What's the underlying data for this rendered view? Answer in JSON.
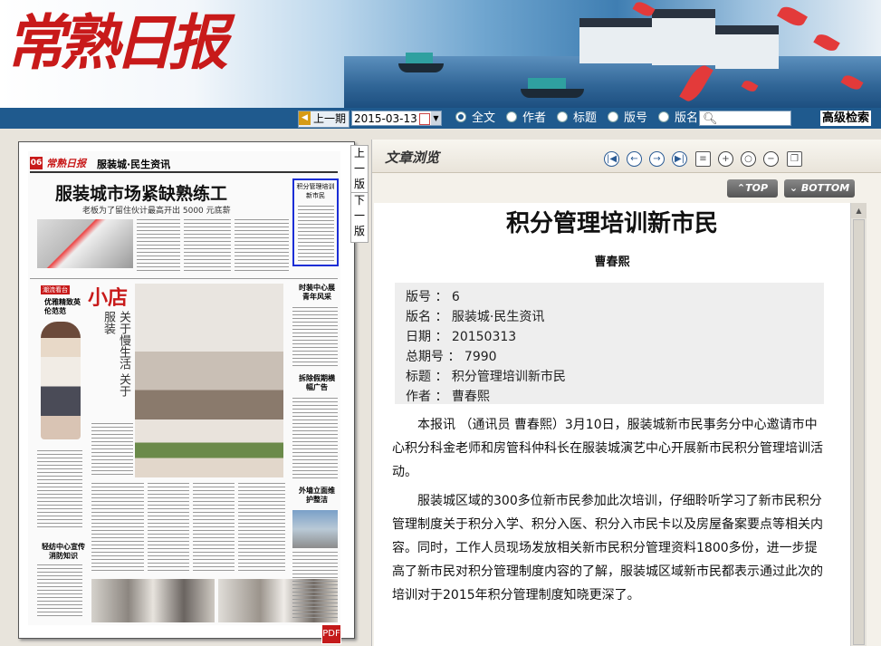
{
  "header": {
    "logo_text": "常熟日报"
  },
  "searchbar": {
    "prev_issue": "上一期",
    "date_value": "2015-03-13",
    "options": [
      {
        "label": "全文",
        "selected": true
      },
      {
        "label": "作者",
        "selected": false
      },
      {
        "label": "标题",
        "selected": false
      },
      {
        "label": "版号",
        "selected": false
      },
      {
        "label": "版名",
        "selected": false
      }
    ],
    "search_placeholder": "",
    "advanced_search": "高级检索"
  },
  "page_nav": {
    "prev_page": "上一版",
    "next_page": "下一版"
  },
  "newspaper": {
    "page_no": "06",
    "masthead": "常熟日报",
    "section": "服装城·民生资讯",
    "headline": "服装城市场紧缺熟练工",
    "subheadline": "老板为了留住伙计最高开出 5000 元底薪",
    "highlight_box": "积分管理培训新市民",
    "col_shop_logo": "小店",
    "col_shop_title": "关于慢生活 关于服装",
    "side_items": [
      "优雅精致英伦范范",
      "时装中心展青年风采",
      "拆除假期横幅广告",
      "外墙立面维护整洁",
      "轻纺中心宣传消防知识"
    ]
  },
  "article_pane": {
    "title": "文章浏览",
    "tools": [
      "first-page",
      "prev",
      "next",
      "last-page",
      "print",
      "zoom-in",
      "zoom-reset",
      "zoom-out",
      "copy"
    ],
    "top_button": "TOP",
    "bottom_button": "BOTTOM"
  },
  "article": {
    "title": "积分管理培训新市民",
    "author": "曹春熙",
    "meta": [
      {
        "label": "版号",
        "value": "6"
      },
      {
        "label": "版名",
        "value": "服装城·民生资讯"
      },
      {
        "label": "日期",
        "value": "20150313"
      },
      {
        "label": "总期号",
        "value": "7990"
      },
      {
        "label": "标题",
        "value": "积分管理培训新市民"
      },
      {
        "label": "作者",
        "value": "曹春熙"
      }
    ],
    "paragraphs": [
      "本报讯 （通讯员 曹春熙）3月10日，服装城新市民事务分中心邀请市中心积分科金老师和房管科仲科长在服装城演艺中心开展新市民积分管理培训活动。",
      "服装城区域的300多位新市民参加此次培训，仔细聆听学习了新市民积分管理制度关于积分入学、积分入医、积分入市民卡以及房屋备案要点等相关内容。同时，工作人员现场发放相关新市民积分管理资料1800多份，进一步提高了新市民对积分管理制度内容的了解，服装城区域新市民都表示通过此次的培训对于2015年积分管理制度知晓更深了。"
    ]
  }
}
